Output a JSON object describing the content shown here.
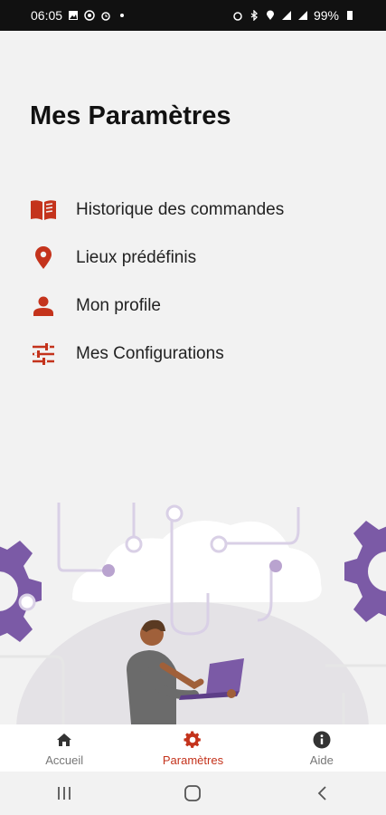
{
  "status_bar": {
    "time": "06:05",
    "battery": "99%"
  },
  "page": {
    "title": "Mes Paramètres"
  },
  "menu": {
    "items": [
      {
        "label": "Historique des commandes",
        "icon": "book-icon"
      },
      {
        "label": "Lieux prédéfinis",
        "icon": "location-pin-icon"
      },
      {
        "label": "Mon profile",
        "icon": "person-icon"
      },
      {
        "label": "Mes Configurations",
        "icon": "sliders-icon"
      }
    ]
  },
  "bottom_nav": {
    "items": [
      {
        "label": "Accueil",
        "icon": "home-icon"
      },
      {
        "label": "Paramètres",
        "icon": "gear-icon"
      },
      {
        "label": "Aide",
        "icon": "info-icon"
      }
    ],
    "active": "Paramètres"
  },
  "colors": {
    "accent": "#c4331c",
    "purple": "#7b5aa6",
    "background": "#f2f2f2"
  }
}
